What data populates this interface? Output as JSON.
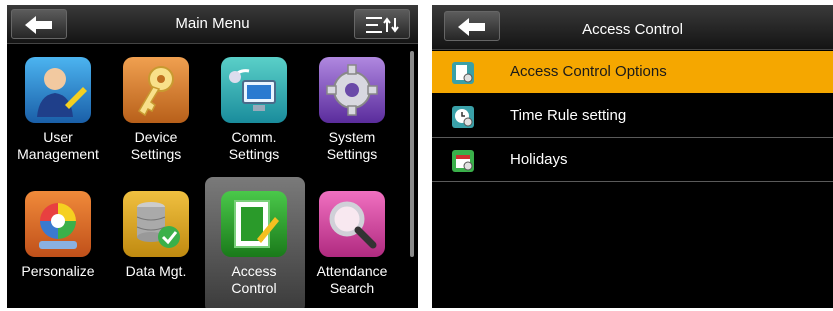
{
  "left": {
    "title": "Main Menu",
    "items": [
      {
        "label1": "User",
        "label2": "Management"
      },
      {
        "label1": "Device",
        "label2": "Settings"
      },
      {
        "label1": "Comm.",
        "label2": "Settings"
      },
      {
        "label1": "System",
        "label2": "Settings"
      },
      {
        "label1": "Personalize",
        "label2": ""
      },
      {
        "label1": "Data Mgt.",
        "label2": ""
      },
      {
        "label1": "Access",
        "label2": "Control"
      },
      {
        "label1": "Attendance",
        "label2": "Search"
      }
    ]
  },
  "right": {
    "title": "Access Control",
    "rows": [
      {
        "label": "Access Control Options"
      },
      {
        "label": "Time Rule setting"
      },
      {
        "label": "Holidays"
      }
    ]
  },
  "colors": {
    "accent": "#f5a700",
    "bg": "#000000"
  },
  "icons": [
    "back-arrow-icon",
    "sort-menu-icon",
    "user-management-icon",
    "device-settings-icon",
    "comm-settings-icon",
    "system-settings-icon",
    "personalize-icon",
    "data-mgt-icon",
    "access-control-icon",
    "attendance-search-icon"
  ]
}
